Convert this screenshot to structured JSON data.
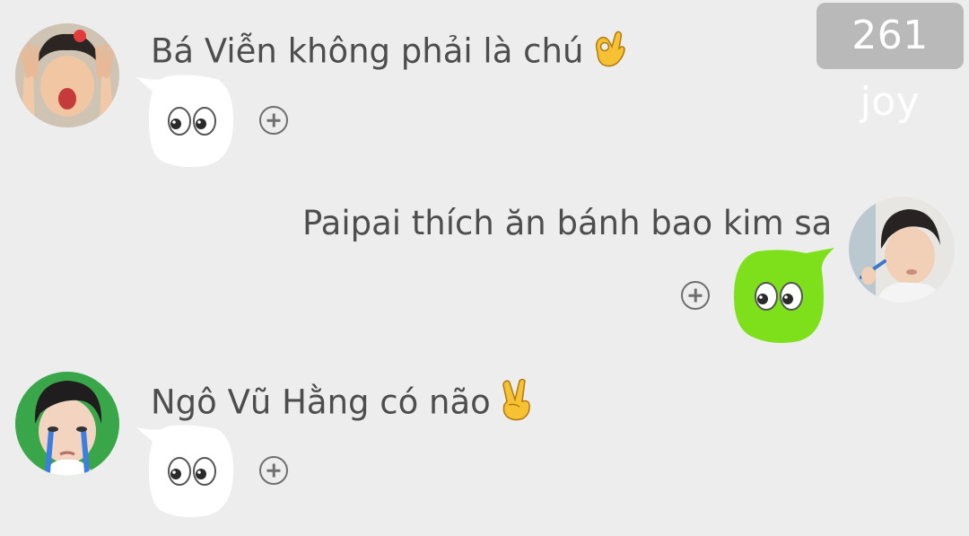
{
  "watermark": {
    "text": "261 joy"
  },
  "messages": [
    {
      "side": "left",
      "text": "Bá Viễn không phải là chú",
      "text_emoji": "ok-hand-emoji",
      "bubble_color": "#ffffff",
      "bubble_icon": "eyes-emoji",
      "action_icon": "add-reaction-icon"
    },
    {
      "side": "right",
      "text": "Paipai thích ăn bánh bao kim sa",
      "bubble_color": "#7ee01a",
      "bubble_icon": "eyes-emoji",
      "action_icon": "add-reaction-icon"
    },
    {
      "side": "left",
      "text": "Ngô Vũ Hằng có não",
      "text_emoji": "victory-hand-emoji",
      "bubble_color": "#ffffff",
      "bubble_icon": "eyes-emoji",
      "action_icon": "add-reaction-icon"
    }
  ]
}
